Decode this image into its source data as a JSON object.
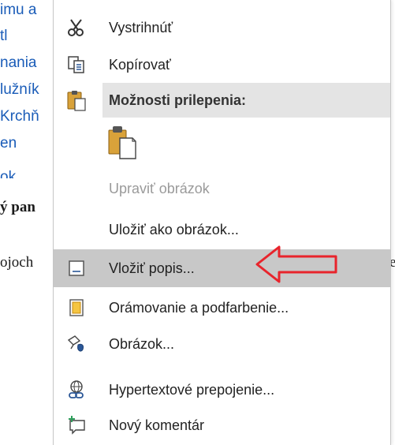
{
  "document": {
    "links": [
      "imu a",
      "tl",
      "nania",
      "lužník",
      "Krchň",
      "en",
      "ok"
    ],
    "bold_text": "ý pan",
    "body_left": "ojoch",
    "body_right": "e"
  },
  "context_menu": {
    "items": [
      {
        "label": "Vystrihnúť",
        "icon": "scissors-icon",
        "enabled": true
      },
      {
        "label": "Kopírovať",
        "icon": "copy-icon",
        "enabled": true
      },
      {
        "label": "Možnosti prilepenia:",
        "icon": "paste-icon",
        "header": true
      },
      {
        "label": "Upraviť obrázok",
        "icon": "",
        "enabled": false
      },
      {
        "label": "Uložiť ako obrázok...",
        "icon": "",
        "enabled": true
      },
      {
        "label": "Vložiť popis...",
        "icon": "caption-icon",
        "enabled": true,
        "highlighted": true
      },
      {
        "label": "Orámovanie a podfarbenie...",
        "icon": "borders-shading-icon",
        "enabled": true
      },
      {
        "label": "Obrázok...",
        "icon": "format-picture-icon",
        "enabled": true
      },
      {
        "label": "Hypertextové prepojenie...",
        "icon": "hyperlink-icon",
        "enabled": true
      },
      {
        "label": "Nový komentár",
        "icon": "new-comment-icon",
        "enabled": true
      }
    ],
    "paste_option_icon": "paste-keep-picture-icon"
  },
  "annotation": {
    "arrow_color": "#e8242c",
    "arrow_direction": "left"
  },
  "colors": {
    "highlight": "#c8c8c8",
    "section_header": "#e4e4e4",
    "link": "#1a5cb8",
    "disabled_text": "#9a9a9a",
    "icon_blue": "#2b5797",
    "icon_gold": "#d9a23a"
  }
}
